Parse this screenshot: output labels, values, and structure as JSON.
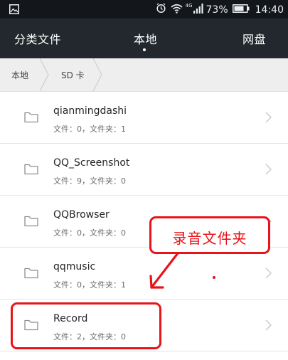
{
  "status_bar": {
    "gallery_icon": "gallery-icon",
    "network_label": "4G",
    "battery_percent": "73%",
    "time": "14:40"
  },
  "tabs": [
    {
      "label": "分类文件"
    },
    {
      "label": "本地"
    },
    {
      "label": "网盘"
    }
  ],
  "breadcrumb": [
    {
      "label": "本地"
    },
    {
      "label": "SD 卡"
    }
  ],
  "files": [
    {
      "name": "qianmingdashi",
      "meta": "文件：0，文件夹：1"
    },
    {
      "name": "QQ_Screenshot",
      "meta": "文件：9，文件夹：0"
    },
    {
      "name": "QQBrowser",
      "meta": "文件：0，文件夹：0"
    },
    {
      "name": "qqmusic",
      "meta": "文件：0，文件夹：1"
    },
    {
      "name": "Record",
      "meta": "文件：2，文件夹：0"
    }
  ],
  "annotation": {
    "callout_text": "录音文件夹",
    "color": "#e8141a"
  },
  "colors": {
    "status_bar_bg": "#13171b",
    "app_bar_bg": "#22282d",
    "breadcrumb_bg": "#eeeeee",
    "list_bg": "#ffffff"
  }
}
